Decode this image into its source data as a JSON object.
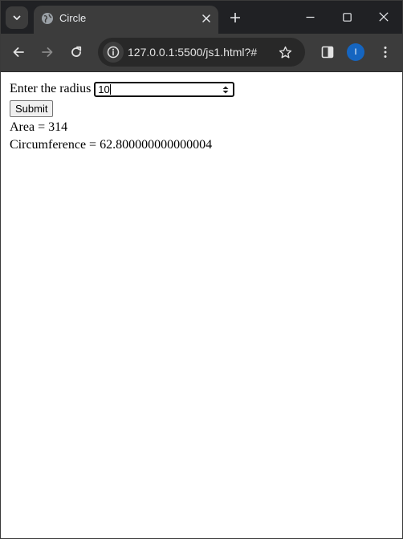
{
  "browser": {
    "tab": {
      "title": "Circle"
    },
    "address_bar": {
      "url": "127.0.0.1:5500/js1.html?#"
    },
    "profile": {
      "initial": "I",
      "color": "#1565c0"
    },
    "icons": {
      "tab_search": "chevron-down-icon",
      "favicon": "globe-icon",
      "tab_close": "close-icon",
      "new_tab": "plus-icon",
      "minimize": "minimize-icon",
      "maximize": "maximize-icon",
      "close_window": "close-icon",
      "back": "arrow-left-icon",
      "forward": "arrow-right-icon",
      "reload": "reload-icon",
      "site_info": "info-icon",
      "bookmark": "star-icon",
      "side_panel": "side-panel-icon",
      "menu": "kebab-menu-icon"
    }
  },
  "page": {
    "radius_label": "Enter the radius",
    "radius_value": "10",
    "submit_label": "Submit",
    "area_text": "Area = 314",
    "circumference_text": "Circumference = 62.800000000000004"
  }
}
